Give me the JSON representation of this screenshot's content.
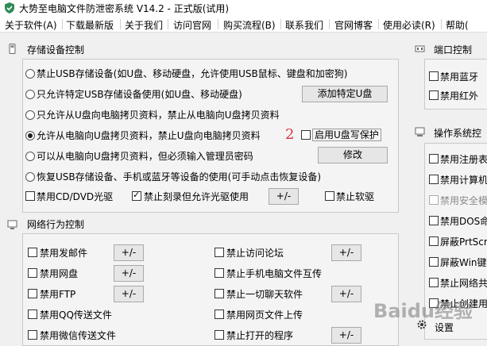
{
  "window": {
    "title": "大势至电脑文件防泄密系统 V14.2 - 正式版(试用)"
  },
  "menu": [
    "关于软件(A)",
    "下载最新版",
    "关于我们",
    "访问官网",
    "购买流程(B)",
    "联系我们",
    "官网博客",
    "使用必读(R)",
    "帮助("
  ],
  "storage": {
    "heading": "存储设备控制",
    "options": [
      "禁止USB存储设备(如U盘、移动硬盘，允许使用USB鼠标、键盘和加密狗)",
      "只允许特定USB存储设备使用(如U盘、移动硬盘)",
      "只允许从U盘向电脑拷贝资料，禁止从电脑向U盘拷贝资料",
      "允许从电脑向U盘拷贝资料，禁止U盘向电脑拷贝资料",
      "可以从电脑向U盘拷贝资料，但必须输入管理员密码",
      "恢复USB存储设备、手机或蓝牙等设备的使用(可手动点击恢复设备)"
    ],
    "selected_index": 3,
    "add_device_button": "添加特定U盘",
    "write_protect_label": "启用U盘写保护",
    "modify_button": "修改",
    "annotation_number": "2",
    "disable_cd": "禁用CD/DVD光驱",
    "disable_burn": "禁止刻录但允许光驱使用",
    "disable_floppy": "禁止软驱",
    "pm_button": "+/-"
  },
  "network": {
    "heading": "网络行为控制",
    "left_items": [
      "禁用发邮件",
      "禁用网盘",
      "禁用FTP",
      "禁用QQ传送文件",
      "禁用微信传送文件"
    ],
    "right_items": [
      "禁止访问论坛",
      "禁止手机电脑文件互传",
      "禁止一切聊天软件",
      "禁用网页文件上传",
      "禁止打开的程序"
    ],
    "pm_button": "+/-"
  },
  "port": {
    "heading": "端口控制",
    "items": [
      "禁用蓝牙",
      "禁用红外"
    ]
  },
  "os": {
    "heading": "操作系统控",
    "items": [
      "禁用注册表",
      "禁用计算机",
      "禁用安全模",
      "禁用DOS命",
      "屏蔽PrtScr",
      "屏蔽Win键",
      "禁止网络共",
      "禁止创建用"
    ],
    "disabled_index": 2,
    "settings_label": "设置"
  },
  "watermark": "Baidu经验"
}
